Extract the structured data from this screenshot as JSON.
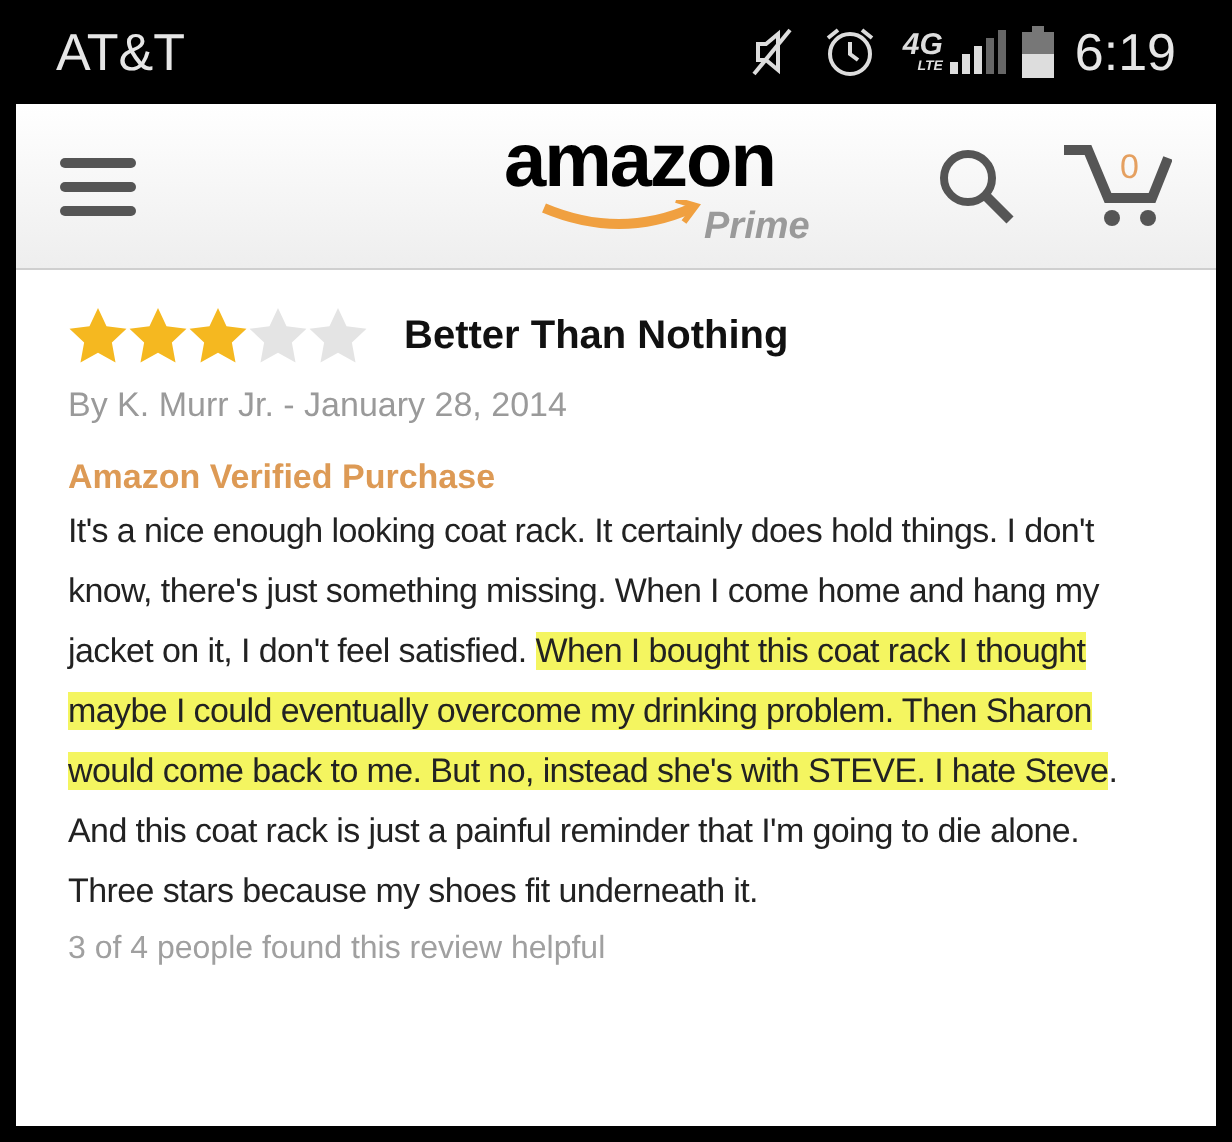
{
  "status_bar": {
    "carrier": "AT&T",
    "network": "4G",
    "network_sub": "LTE",
    "time": "6:19"
  },
  "header": {
    "logo": "amazon",
    "logo_sub": "Prime",
    "cart_count": "0"
  },
  "review": {
    "stars": 3,
    "title": "Better Than Nothing",
    "byline": "By K. Murr Jr. - January 28, 2014",
    "badge": "Amazon Verified Purchase",
    "body": [
      {
        "text": "It's a nice enough looking coat rack. It certainly does hold things. I don't know, there's just something missing. When I come home and hang my jacket on it, I don't feel satisfied. ",
        "highlighted": false
      },
      {
        "text": "When I bought this coat rack I thought maybe I could eventually overcome my drinking problem. Then Sharon would come back to me. But no, instead she's with STEVE. I hate Steve",
        "highlighted": true
      },
      {
        "text": ". And this coat rack is just a painful reminder that I'm going to die alone. Three stars because my shoes fit underneath it.",
        "highlighted": false
      }
    ],
    "helpful": "3 of 4 people found this review helpful"
  }
}
